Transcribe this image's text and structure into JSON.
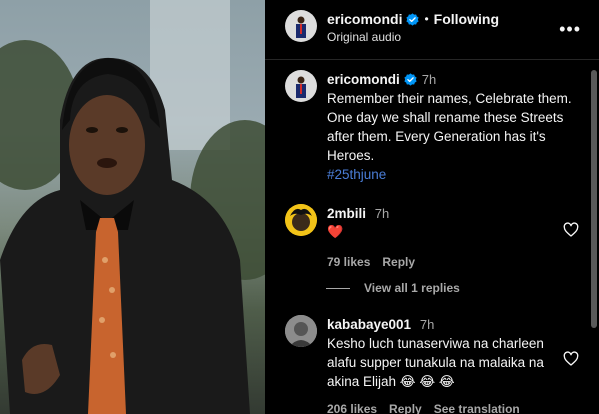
{
  "post": {
    "username": "ericomondi",
    "following_label": "Following",
    "audio_label": "Original audio",
    "more_icon": "more-horizontal-icon"
  },
  "caption": {
    "username": "ericomondi",
    "time": "7h",
    "text": "Remember their names, Celebrate them. One day we shall rename these Streets after them. Every Generation has it's Heroes.",
    "hashtag": "#25thjune"
  },
  "comments": [
    {
      "username": "2mbili",
      "time": "7h",
      "text": "❤️",
      "likes": "79 likes",
      "reply": "Reply"
    },
    {
      "username": "kababaye001",
      "time": "7h",
      "text": "Kesho luch tunaserviwa na charleen alafu supper tunakula na malaika na akina Elijah 😂 😂 😂",
      "likes": "206 likes",
      "reply": "Reply",
      "translation": "See translation"
    }
  ],
  "view_all_replies": "View all 1 replies",
  "colors": {
    "background": "#000000",
    "text": "#f5f5f5",
    "muted": "#a8a8a8",
    "hashtag": "#4a7dd6",
    "verified": "#0095f6",
    "heart": "#ff3040"
  }
}
